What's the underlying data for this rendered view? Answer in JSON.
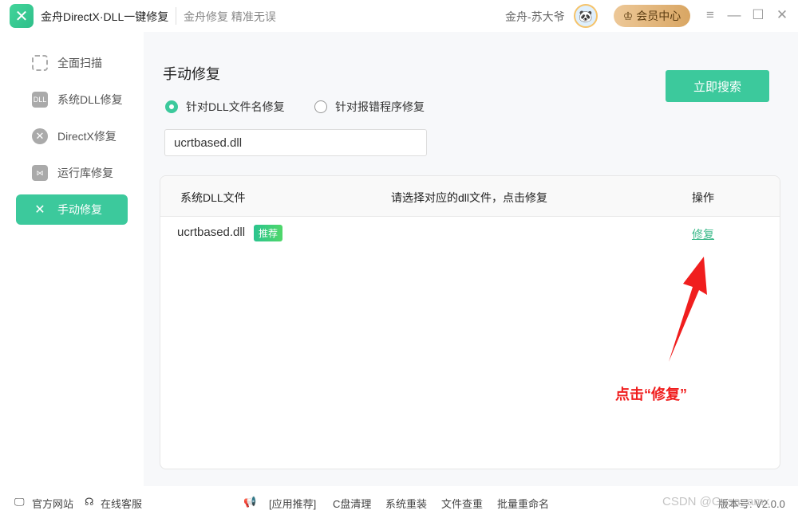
{
  "titlebar": {
    "app_title": "金舟DirectX·DLL一键修复",
    "slogan": "金舟修复 精准无误",
    "username": "金舟-苏大爷",
    "vip_label": "会员中心"
  },
  "sidebar": {
    "items": [
      {
        "label": "全面扫描"
      },
      {
        "label": "系统DLL修复"
      },
      {
        "label": "DirectX修复"
      },
      {
        "label": "运行库修复"
      },
      {
        "label": "手动修复"
      }
    ]
  },
  "main": {
    "title": "手动修复",
    "radio_options": [
      "针对DLL文件名修复",
      "针对报错程序修复"
    ],
    "search_value": "ucrtbased.dll",
    "search_button": "立即搜索",
    "table": {
      "headers": [
        "系统DLL文件",
        "请选择对应的dll文件，点击修复",
        "操作"
      ],
      "rows": [
        {
          "file": "ucrtbased.dll",
          "badge": "推荐",
          "action": "修复"
        }
      ]
    },
    "callout": "点击“修复”"
  },
  "footer": {
    "website": "官方网站",
    "service": "在线客服",
    "links": [
      "[应用推荐]",
      "C盘清理",
      "系统重装",
      "文件查重",
      "批量重命名"
    ],
    "version": "版本号: V2.0.0",
    "watermark": "CSDN @Gasa_amx"
  },
  "colors": {
    "accent": "#3cc99c",
    "callout": "#f01e1e"
  }
}
